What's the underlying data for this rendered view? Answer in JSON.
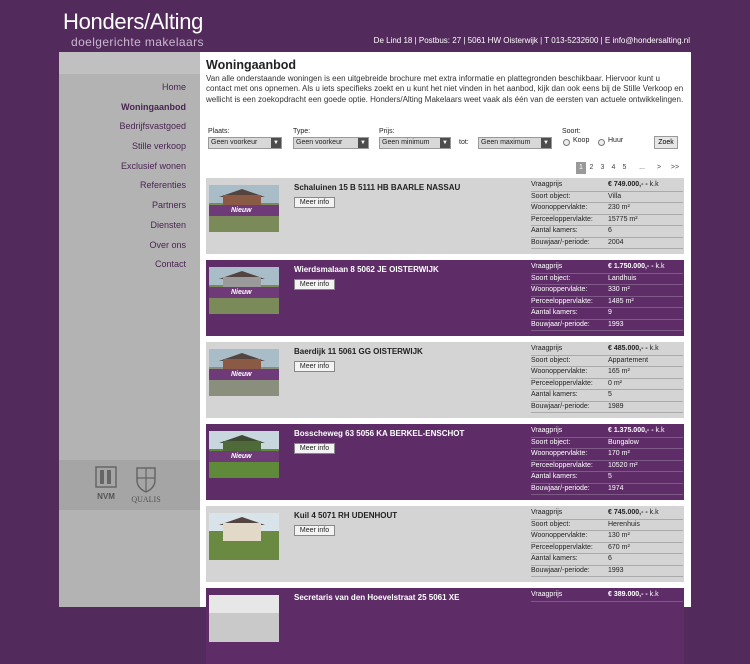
{
  "header": {
    "logo_name": "Honders/Alting",
    "logo_tagline": "doelgerichte makelaars",
    "contact": "De Lind 18 | Postbus: 27 | 5061 HW Oisterwijk | T 013-5232600 | E info@hondersalting.nl"
  },
  "sidebar": {
    "items": [
      {
        "label": "Home",
        "active": false
      },
      {
        "label": "Woningaanbod",
        "active": true
      },
      {
        "label": "Bedrijfsvastgoed",
        "active": false
      },
      {
        "label": "Stille verkoop",
        "active": false
      },
      {
        "label": "Exclusief wonen",
        "active": false
      },
      {
        "label": "Referenties",
        "active": false
      },
      {
        "label": "Partners",
        "active": false
      },
      {
        "label": "Diensten",
        "active": false
      },
      {
        "label": "Over ons",
        "active": false
      },
      {
        "label": "Contact",
        "active": false
      }
    ],
    "logos": {
      "nvm": "NVM",
      "qualis": "QUALIS"
    }
  },
  "main": {
    "title": "Woningaanbod",
    "intro": "Van alle onderstaande woningen is een uitgebreide brochure met extra informatie en plattegronden beschikbaar. Hiervoor kunt u contact met ons opnemen. Als u iets specifieks zoekt en u kunt het niet vinden in het aanbod, kijk dan ook eens bij de Stille Verkoop en wellicht is een zoekopdracht een goede optie. Honders/Alting Makelaars weet vaak als één van de eersten van actuele ontwikkelingen."
  },
  "filters": {
    "plaats_label": "Plaats:",
    "plaats_value": "Geen voorkeur",
    "type_label": "Type:",
    "type_value": "Geen voorkeur",
    "prijs_label": "Prijs:",
    "prijs_min": "Geen minimum",
    "tot_label": "tot:",
    "prijs_max": "Geen maximum",
    "soort_label": "Soort:",
    "koop_label": "Koop",
    "huur_label": "Huur",
    "zoek_label": "Zoek"
  },
  "pager": {
    "pages": [
      "1",
      "2",
      "3",
      "4",
      "5"
    ],
    "current": "1",
    "ellipsis": "...",
    "next": ">",
    "last": ">>"
  },
  "spec_labels": {
    "price": "Vraagprijs",
    "type": "Soort object:",
    "living": "Woonoppervlakte:",
    "plot": "Perceeloppervlakte:",
    "rooms": "Aantal kamers:",
    "year": "Bouwjaar/-periode:"
  },
  "badge_label": "Nieuw",
  "more_label": "Meer info",
  "listings": [
    {
      "title": "Schaluinen 15 B 5111 HB BAARLE NASSAU",
      "price": "€ 749.000,-",
      "price_suffix": "k.k",
      "type": "Villa",
      "living": "230 m²",
      "plot": "15775 m²",
      "rooms": "6",
      "year": "2004",
      "new": true
    },
    {
      "title": "Wierdsmalaan 8 5062 JE OISTERWIJK",
      "price": "€ 1.750.000,-",
      "price_suffix": "k.k",
      "type": "Landhuis",
      "living": "330 m²",
      "plot": "1485 m²",
      "rooms": "9",
      "year": "1993",
      "new": true
    },
    {
      "title": "Baerdijk 11 5061 GG OISTERWIJK",
      "price": "€ 485.000,-",
      "price_suffix": "k.k",
      "type": "Appartement",
      "living": "165 m²",
      "plot": "0 m²",
      "rooms": "5",
      "year": "1989",
      "new": true
    },
    {
      "title": "Bosscheweg 63 5056 KA BERKEL-ENSCHOT",
      "price": "€ 1.375.000,-",
      "price_suffix": "k.k",
      "type": "Bungalow",
      "living": "170 m²",
      "plot": "10520 m²",
      "rooms": "5",
      "year": "1974",
      "new": true
    },
    {
      "title": "Kuil 4 5071 RH UDENHOUT",
      "price": "€ 745.000,-",
      "price_suffix": "k.k",
      "type": "Herenhuis",
      "living": "130 m²",
      "plot": "670 m²",
      "rooms": "6",
      "year": "1993",
      "new": false
    },
    {
      "title": "Secretaris van den Hoevelstraat 25 5061 XE",
      "price": "€ 389.000,-",
      "price_suffix": "k.k",
      "type": "",
      "living": "",
      "plot": "",
      "rooms": "",
      "year": "",
      "new": false
    }
  ]
}
